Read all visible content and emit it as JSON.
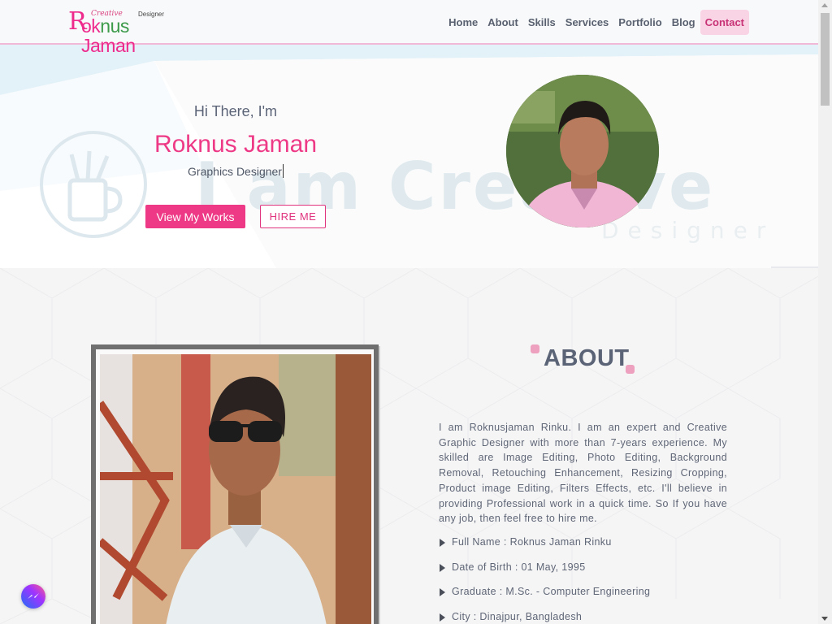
{
  "logo": {
    "initial": "R",
    "name_part1": "ok",
    "name_part2": "nus",
    "name_part3": " Jaman",
    "tag_creative": "Creative",
    "tag_designer": "Designer"
  },
  "nav": {
    "items": [
      {
        "label": "Home"
      },
      {
        "label": "About"
      },
      {
        "label": "Skills"
      },
      {
        "label": "Services"
      },
      {
        "label": "Portfolio"
      },
      {
        "label": "Blog"
      },
      {
        "label": "Contact"
      }
    ],
    "active": "Contact"
  },
  "hero": {
    "greeting": "Hi There, I'm",
    "name": "Roknus Jaman",
    "role": "Graphics Designer",
    "bg_text": "I am Creative",
    "bg_subtext": "Designer",
    "primary_button": "View My Works",
    "secondary_button": "HIRE ME"
  },
  "about": {
    "title": "ABOUT",
    "paragraph": "I am Roknusjaman Rinku. I am an expert and Creative Graphic Designer with more than 7-years experience. My skilled are Image Editing, Photo Editing, Background Removal, Retouching Enhancement, Resizing Cropping, Product image Editing, Filters Effects, etc. I'll believe in providing Professional work in a quick time. So If you have any job, then feel free to hire me.",
    "info": [
      {
        "text": "Full Name : Roknus Jaman Rinku"
      },
      {
        "text": "Date of Birth : 01 May, 1995"
      },
      {
        "text": "Graduate : M.Sc. - Computer Engineering"
      },
      {
        "text": "City : Dinajpur, Bangladesh"
      }
    ]
  },
  "icons": {
    "messenger": "messenger-icon",
    "bullet": "caret-right-icon",
    "mug": "pencil-cup-icon"
  },
  "colors": {
    "accent": "#ee3a86",
    "nav_active_bg": "#f9d4e4",
    "text": "#5b6477"
  }
}
